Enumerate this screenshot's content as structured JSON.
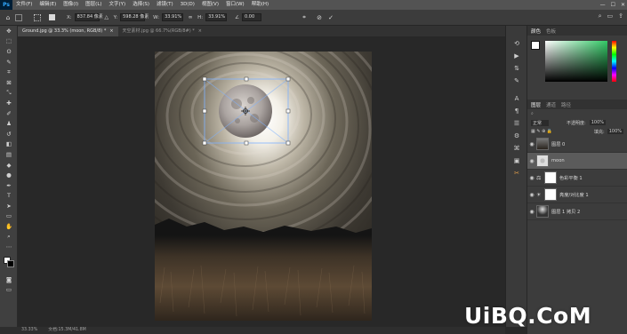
{
  "menubar": {
    "logo": "Ps",
    "items": [
      "文件(F)",
      "编辑(E)",
      "图像(I)",
      "图层(L)",
      "文字(Y)",
      "选择(S)",
      "滤镜(T)",
      "3D(D)",
      "视图(V)",
      "窗口(W)",
      "帮助(H)"
    ],
    "window_controls": [
      "—",
      "☐",
      "✕"
    ]
  },
  "options": {
    "x_label": "X:",
    "x_value": "837.84 像素",
    "y_label": "Y:",
    "y_value": "598.28 像素",
    "w_label": "W:",
    "w_value": "33.91%",
    "h_label": "H:",
    "h_value": "33.91%",
    "angle_label": "∠",
    "angle_value": "0.00",
    "cancel_glyph": "⊘",
    "commit_glyph": "✓"
  },
  "tabs": [
    {
      "label": "Ground.jpg @ 33.3% (moon, RGB/8) *",
      "close": "×",
      "active": true
    },
    {
      "label": "天空素材.jpg @ 66.7%(RGB/8#) *",
      "close": "×",
      "active": false
    }
  ],
  "status": {
    "zoom": "33.33%",
    "doc_info": "文档:15.3M/41.8M"
  },
  "color_panel": {
    "tabs": [
      "颜色",
      "色板"
    ],
    "hue_gradient": [
      "#ffffff",
      "#33c966",
      "#000000"
    ]
  },
  "layers_panel": {
    "tabs": [
      "图层",
      "通道",
      "路径"
    ],
    "blend_mode": "正常",
    "opacity_label": "不透明度:",
    "opacity_value": "100%",
    "fill_label": "填充:",
    "fill_value": "100%",
    "layers": [
      {
        "name": "图层 0",
        "selected": false
      },
      {
        "name": "moon",
        "selected": true
      },
      {
        "name": "色彩平衡 1",
        "selected": false
      },
      {
        "name": "亮度/对比度 1",
        "selected": false
      },
      {
        "name": "图层 1 拷贝 2",
        "selected": false
      }
    ]
  },
  "watermark": "UiBQ.CoM",
  "colors": {
    "menubar": "#535353",
    "panel": "#3c3c3c",
    "canvas_bg": "#282828",
    "selected_layer": "#5b5b5b",
    "transform_box": "#7fb2ff"
  }
}
